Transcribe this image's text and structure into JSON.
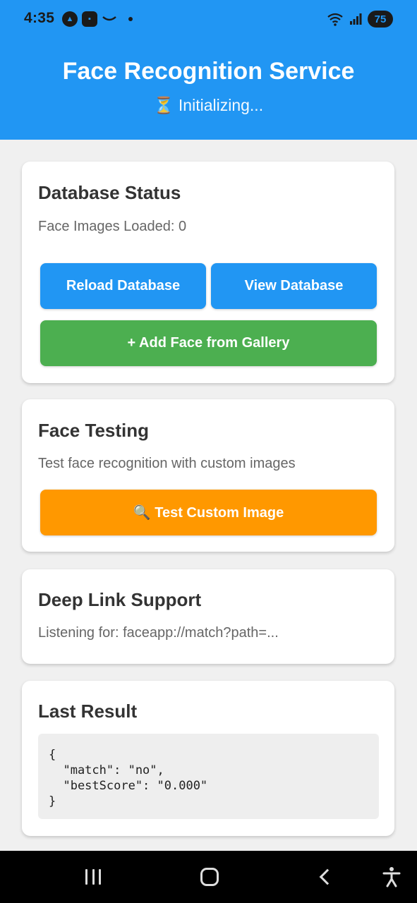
{
  "status_bar": {
    "time": "4:35",
    "battery": "75",
    "left_icons": [
      "app-icon-a",
      "app-icon-blue",
      "amazon-icon",
      "dot-icon"
    ],
    "right_icons": [
      "wifi-icon",
      "signal-icon"
    ]
  },
  "header": {
    "title": "Face Recognition Service",
    "status": "⏳ Initializing...",
    "color": "#2196F3"
  },
  "database_card": {
    "title": "Database Status",
    "info": "Face Images Loaded: 0",
    "reload_label": "Reload Database",
    "view_label": "View Database",
    "add_label": "+ Add Face from Gallery"
  },
  "testing_card": {
    "title": "Face Testing",
    "info": "Test face recognition with custom images",
    "test_label": "🔍 Test Custom Image"
  },
  "deeplink_card": {
    "title": "Deep Link Support",
    "info": "Listening for: faceapp://match?path=..."
  },
  "result_card": {
    "title": "Last Result",
    "json_text": "{\n  \"match\": \"no\",\n  \"bestScore\": \"0.000\"\n}"
  },
  "colors": {
    "blue": "#2196F3",
    "green": "#4CAF50",
    "orange": "#FF9800"
  },
  "nav_bar": {
    "icons": [
      "recent-apps-icon",
      "home-icon",
      "back-icon",
      "accessibility-icon"
    ]
  }
}
